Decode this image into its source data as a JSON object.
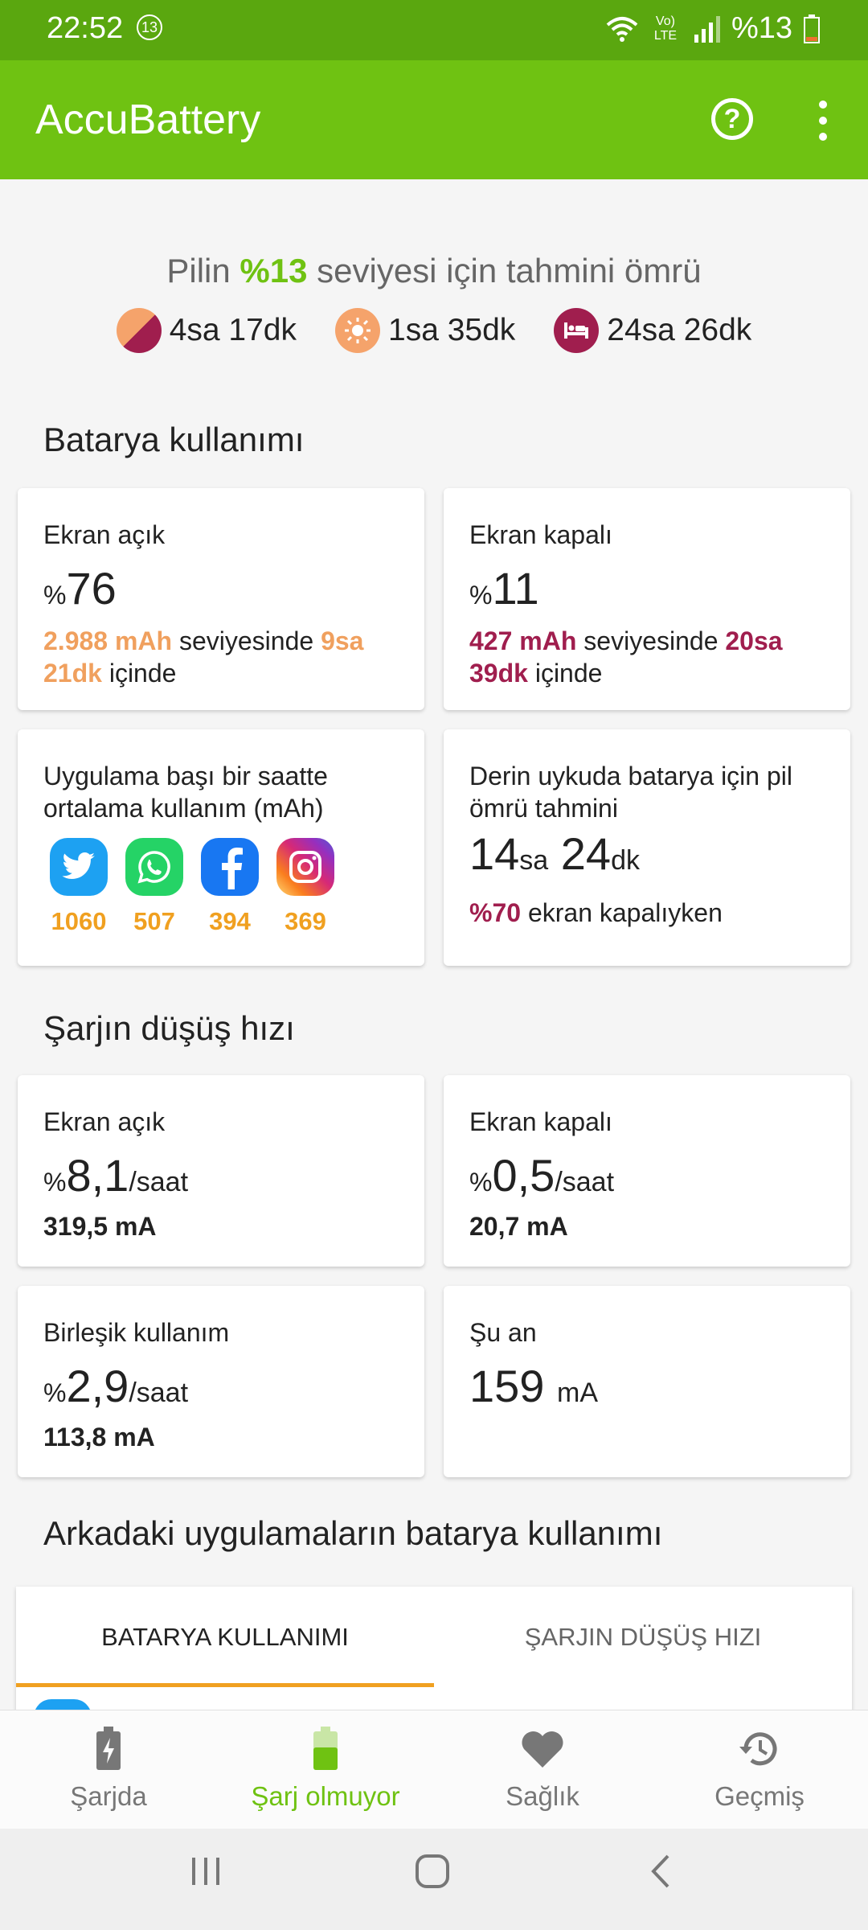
{
  "status_bar": {
    "time": "22:52",
    "notification_count": "13",
    "network": "Vo) LTE",
    "battery_percent": "%13"
  },
  "app_bar": {
    "title": "AccuBattery",
    "help_symbol": "?"
  },
  "estimate": {
    "title_pre": "Pilin ",
    "title_level": "%13",
    "title_post": " seviyesi için tahmini ömrü",
    "mixed": "4sa 17dk",
    "screen_on": "1sa 35dk",
    "screen_off": "24sa 26dk"
  },
  "battery_usage": {
    "title": "Batarya kullanımı",
    "screen_on": {
      "label": "Ekran açık",
      "pct_symbol": "%",
      "value": "76",
      "mah": "2.988 mAh",
      "mid": " seviyesinde ",
      "duration": "9sa 21dk",
      "end": " içinde"
    },
    "screen_off": {
      "label": "Ekran kapalı",
      "pct_symbol": "%",
      "value": "11",
      "mah": "427 mAh",
      "mid": " seviyesinde ",
      "duration": "20sa 39dk",
      "end": " içinde"
    },
    "per_app": {
      "label": "Uygulama başı bir saatte ortalama kullanım (mAh)",
      "apps": [
        {
          "icon": "twitter-icon",
          "value": "1060"
        },
        {
          "icon": "whatsapp-icon",
          "value": "507"
        },
        {
          "icon": "facebook-icon",
          "value": "394"
        },
        {
          "icon": "instagram-icon",
          "value": "369"
        }
      ]
    },
    "deep_sleep": {
      "label": "Derin uykuda  batarya için pil ömrü tahmini",
      "hours": "14",
      "hours_unit": "sa",
      "minutes": "24",
      "minutes_unit": "dk",
      "pct": "%70",
      "pct_text": " ekran kapalıyken"
    }
  },
  "discharge": {
    "title": "Şarjın düşüş hızı",
    "screen_on": {
      "label": "Ekran açık",
      "pct_symbol": "%",
      "value": "8,1",
      "unit": "/saat",
      "ma": "319,5 mA"
    },
    "screen_off": {
      "label": "Ekran kapalı",
      "pct_symbol": "%",
      "value": "0,5",
      "unit": "/saat",
      "ma": "20,7 mA"
    },
    "combined": {
      "label": "Birleşik kullanım",
      "pct_symbol": "%",
      "value": "2,9",
      "unit": "/saat",
      "ma": "113,8 mA"
    },
    "now": {
      "label": "Şu an",
      "value": "159",
      "unit": "mA"
    }
  },
  "background_apps": {
    "title": "Arkadaki uygulamaların batarya kullanımı",
    "tabs": [
      "BATARYA KULLANIMI",
      "ŞARJIN DÜŞÜŞ HIZI"
    ]
  },
  "bottom_nav": [
    {
      "label": "Şarjda",
      "icon": "battery-charging-icon"
    },
    {
      "label": "Şarj olmuyor",
      "icon": "battery-discharging-icon",
      "active": true
    },
    {
      "label": "Sağlık",
      "icon": "heart-icon"
    },
    {
      "label": "Geçmiş",
      "icon": "history-icon"
    }
  ],
  "colors": {
    "accent": "#6fc212",
    "status_bar": "#5aa70f",
    "orange": "#f0a05e",
    "maroon": "#a01e4e",
    "red": "#e0532c",
    "app_value": "#f0a020"
  }
}
